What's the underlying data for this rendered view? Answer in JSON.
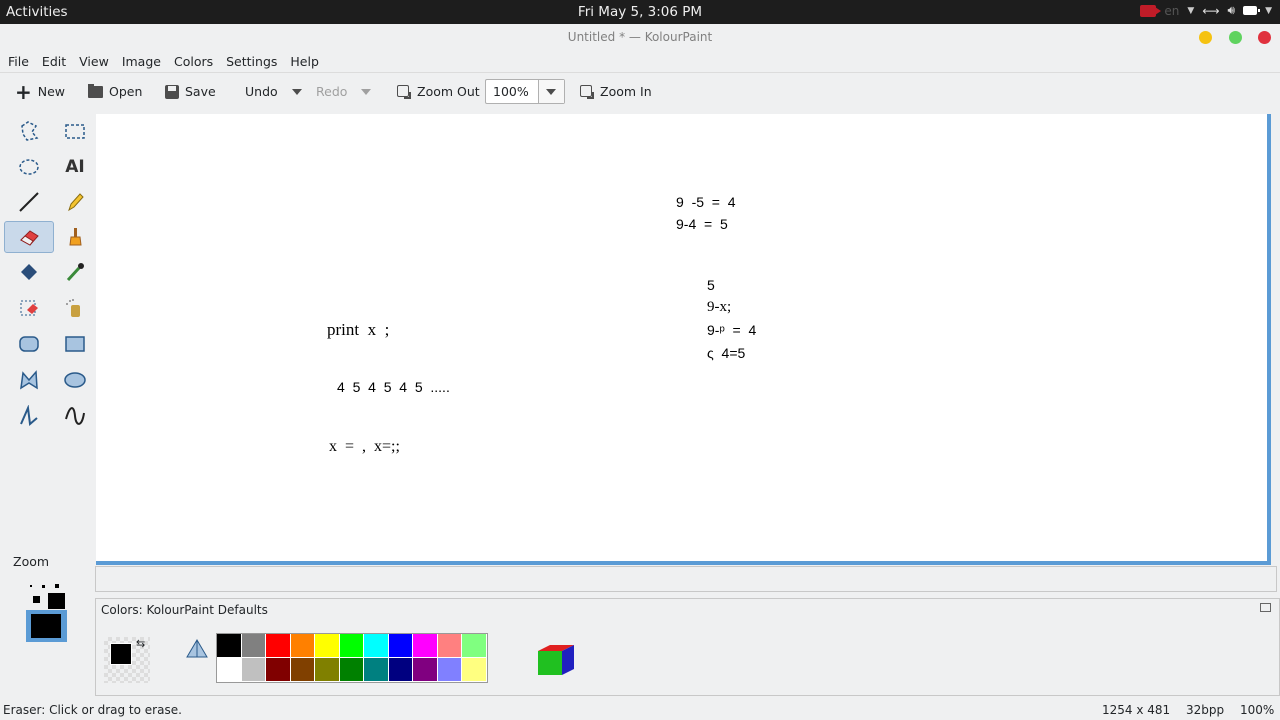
{
  "topbar": {
    "activities": "Activities",
    "clock": "Fri May  5,  3:06 PM",
    "lang": "en"
  },
  "window": {
    "title": "Untitled * — KolourPaint"
  },
  "menu": [
    "File",
    "Edit",
    "View",
    "Image",
    "Colors",
    "Settings",
    "Help"
  ],
  "toolbar": {
    "new_label": "New",
    "open_label": "Open",
    "save_label": "Save",
    "undo_label": "Undo",
    "redo_label": "Redo",
    "zoom_out_label": "Zoom Out",
    "zoom_value": "100%",
    "zoom_in_label": "Zoom In"
  },
  "tools": {
    "zoom_label": "Zoom",
    "items": [
      "free-form-selection",
      "rectangular-selection",
      "elliptical-selection",
      "text",
      "line",
      "pen",
      "eraser",
      "brush",
      "flood-fill",
      "color-picker",
      "color-eraser",
      "spraycan",
      "rounded-rectangle",
      "rectangle",
      "polygon",
      "ellipse",
      "polyline",
      "curve"
    ],
    "selected": "eraser"
  },
  "canvas": {
    "lines": {
      "eq1": "9  -5  =  4",
      "eq2": "9-4  =  5",
      "n5": "5",
      "nx": "9-x;",
      "n9f": "9-ᵖ  =  4",
      "n84": "ς  4=5",
      "print": "print  x  ;",
      "seq": "4  5  4  5  4  5  .....",
      "xassign": "x  =  ,  x=;;"
    }
  },
  "colors_panel": {
    "title": "Colors: KolourPaint Defaults",
    "foreground": "#000000",
    "palette_row1": [
      "#000000",
      "#808080",
      "#ff0000",
      "#ff8000",
      "#ffff00",
      "#00ff00",
      "#00ffff",
      "#0000ff",
      "#ff00ff",
      "#ff8080",
      "#80ff80"
    ],
    "palette_row2": [
      "#ffffff",
      "#c0c0c0",
      "#800000",
      "#804000",
      "#808000",
      "#008000",
      "#008080",
      "#000080",
      "#800080",
      "#8080ff",
      "#ffff80"
    ]
  },
  "statusbar": {
    "message": "Eraser: Click or drag to erase.",
    "image_size": "1254 x 481",
    "bpp": "32bpp",
    "zoom": "100%"
  }
}
